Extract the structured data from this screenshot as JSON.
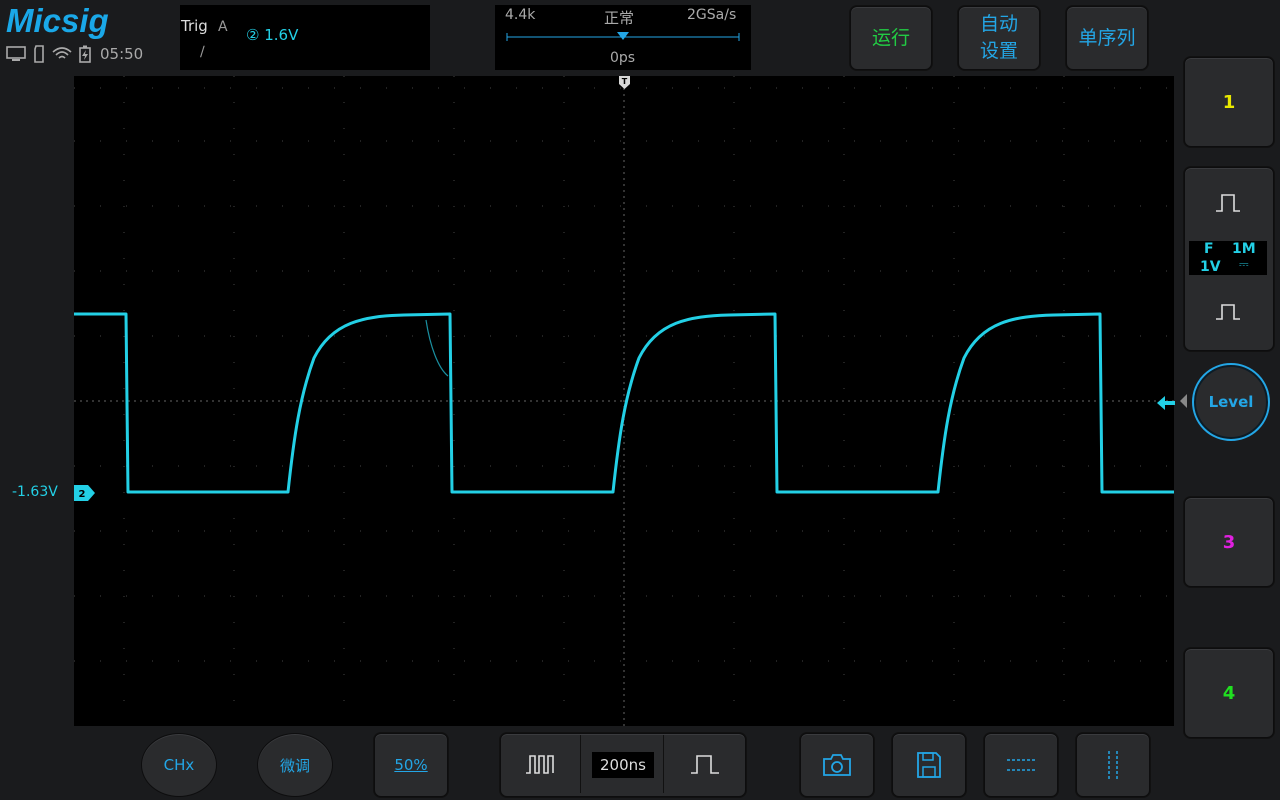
{
  "brand": "Micsig",
  "status": {
    "clock": "05:50"
  },
  "trigger": {
    "label": "Trig",
    "mode": "A",
    "slope": "∕",
    "source": "② 1.6V"
  },
  "timebase": {
    "count": "4.4k",
    "mode": "正常",
    "rate": "2GSa/s",
    "delay": "0ps",
    "scale": "200ns"
  },
  "top_buttons": {
    "run": "运行",
    "auto_line1": "自动",
    "auto_line2": "设置",
    "sequence": "单序列"
  },
  "channels": {
    "ch1": {
      "label": "1",
      "color": "#e8e800"
    },
    "ch2": {
      "marker": "2",
      "offset": "-1.63V",
      "color": "#23d0e6",
      "coupling": "F",
      "impedance": "1M",
      "scale": "1V",
      "dc_symbol": "⎓"
    },
    "ch3": {
      "label": "3",
      "color": "#e020e0"
    },
    "ch4": {
      "label": "4",
      "color": "#20e020"
    }
  },
  "level_button": "Level",
  "trigger_marker": "T",
  "bottom": {
    "chx": "CHx",
    "fine": "微调",
    "fifty": "50%"
  },
  "colors": {
    "accent": "#23a6e6",
    "trace": "#23d0e6",
    "run_green": "#22cc44"
  }
}
